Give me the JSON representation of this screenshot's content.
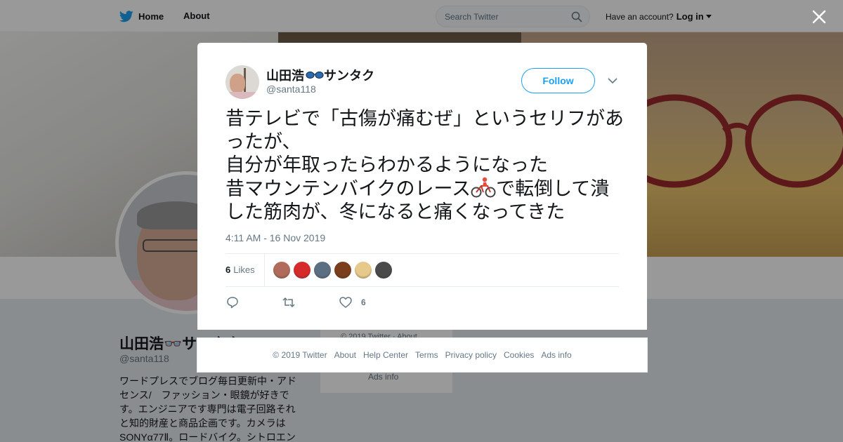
{
  "topbar": {
    "home": "Home",
    "about": "About",
    "search_placeholder": "Search Twitter",
    "have_account": "Have an account?",
    "login": "Log in"
  },
  "profile": {
    "name": "山田浩👓サンタク",
    "handle": "@santa118",
    "bio": "ワードプレスでブログ毎日更新中・アドセンス/　ファッション・眼鏡が好きです。エンジニアです専門は電子回路それと知的財産と商品企画です。カメラはSONYα77Ⅱ。ロードバイク。シトロエン",
    "sidebar_copyright": "© 2019 Twitter",
    "sidebar_about": "About",
    "sidebar_ads": "Ads info"
  },
  "tweet": {
    "author_name": "山田浩",
    "author_name_suffix": "サンタク",
    "author_handle": "@santa118",
    "follow_label": "Follow",
    "text_part1": "昔テレビで「古傷が痛むぜ」というセリフがあったが、\n自分が年取ったらわかるようになった\n昔マウンテンバイクのレース",
    "text_part2": "で転倒して潰した筋肉が、冬になると痛くなってきた",
    "timestamp": "4:11 AM - 16 Nov 2019",
    "likes_count": "6",
    "likes_label": "Likes",
    "like_action_count": "6",
    "likers": [
      {
        "color": "#b06b5a"
      },
      {
        "color": "#d62b2b"
      },
      {
        "color": "#5c6f82"
      },
      {
        "color": "#7a3e1c"
      },
      {
        "color": "#e8c98c"
      },
      {
        "color": "#4a4a4a"
      }
    ]
  },
  "footer": {
    "links": [
      "© 2019 Twitter",
      "About",
      "Help Center",
      "Terms",
      "Privacy policy",
      "Cookies",
      "Ads info"
    ]
  },
  "colors": {
    "accent": "#1da1f2",
    "muted": "#657786",
    "text": "#14171a",
    "like_bar": "#e6ecf0"
  }
}
